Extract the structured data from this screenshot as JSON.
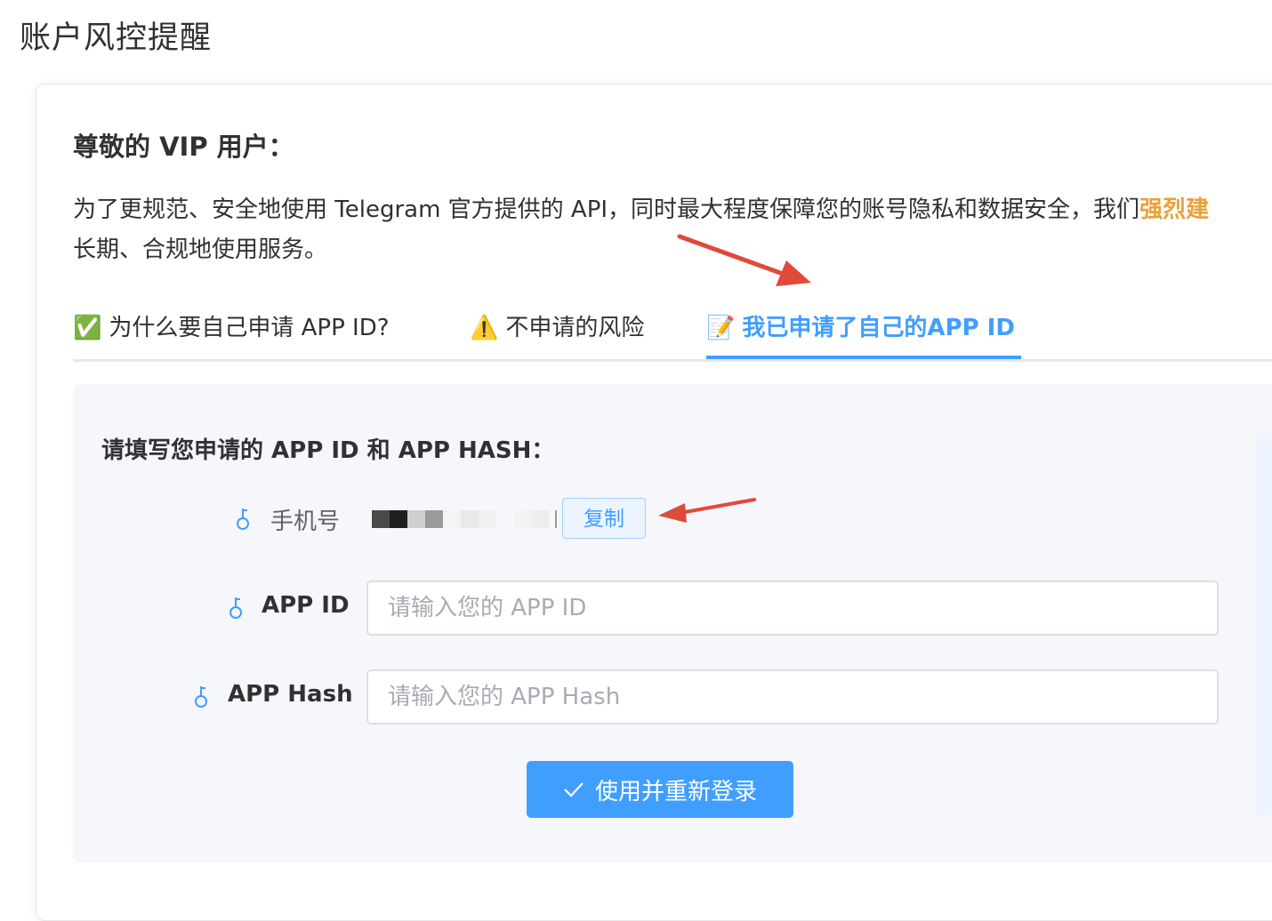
{
  "page": {
    "title": "账户风控提醒"
  },
  "notice": {
    "greeting": "尊敬的 VIP 用户：",
    "intro_line1": "为了更规范、安全地使用 Telegram 官方提供的 API，同时最大程度保障您的账号隐私和数据安全，我们",
    "intro_strong": "强烈建",
    "intro_line2": "长期、合规地使用服务。"
  },
  "tabs": [
    {
      "emoji": "✅",
      "label": "为什么要自己申请 APP ID?"
    },
    {
      "emoji": "⚠️",
      "label": "不申请的风险"
    },
    {
      "emoji": "📝",
      "label": "我已申请了自己的APP ID",
      "active": true
    }
  ],
  "form": {
    "title": "请填写您申请的 APP ID 和 APP HASH：",
    "phone_label": "手机号",
    "copy_label": "复制",
    "app_id_label": "APP ID",
    "app_id_placeholder": "请输入您的 APP ID",
    "app_hash_label": "APP Hash",
    "app_hash_placeholder": "请输入您的 APP Hash",
    "submit_label": "使用并重新登录"
  },
  "colors": {
    "accent": "#409eff",
    "warning": "#e6a23c",
    "annotation_arrow": "#e04a3a"
  }
}
